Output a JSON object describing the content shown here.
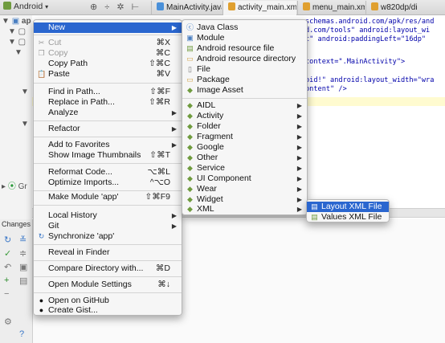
{
  "toolbar": {
    "project_view": "Android",
    "tabs": [
      {
        "label": "MainActivity.java",
        "icon": "java-file-icon"
      },
      {
        "label": "activity_main.xml",
        "icon": "xml-file-icon"
      },
      {
        "label": "menu_main.xml",
        "icon": "xml-file-icon"
      },
      {
        "label": "w820dp/di",
        "icon": "xml-file-icon"
      }
    ]
  },
  "tree": {
    "root": "ap",
    "gradle": "Gr"
  },
  "changes_label": "Changes",
  "code_lines": [
    "schemas.android.com/apk/res/and",
    "d.com/tools\" android:layout_wi",
    "t\" android:paddingLeft=\"16dp\"",
    "context=\".MainActivity\">",
    "oid!\" android:layout_width=\"wra",
    "ontent\" />"
  ],
  "main_menu": {
    "new": "New",
    "cut": "Cut",
    "cut_sc": "⌘X",
    "copy": "Copy",
    "copy_sc": "⌘C",
    "copy_path": "Copy Path",
    "copy_path_sc": "⇧⌘C",
    "paste": "Paste",
    "paste_sc": "⌘V",
    "find_in_path": "Find in Path...",
    "find_in_path_sc": "⇧⌘F",
    "replace_in_path": "Replace in Path...",
    "replace_in_path_sc": "⇧⌘R",
    "analyze": "Analyze",
    "refactor": "Refactor",
    "add_to_favorites": "Add to Favorites",
    "show_thumbnails": "Show Image Thumbnails",
    "show_thumbnails_sc": "⇧⌘T",
    "reformat": "Reformat Code...",
    "reformat_sc": "⌥⌘L",
    "optimize": "Optimize Imports...",
    "optimize_sc": "^⌥O",
    "make_module": "Make Module 'app'",
    "make_module_sc": "⇧⌘F9",
    "local_history": "Local History",
    "git": "Git",
    "synchronize": "Synchronize 'app'",
    "reveal": "Reveal in Finder",
    "compare": "Compare Directory with...",
    "compare_sc": "⌘D",
    "module_settings": "Open Module Settings",
    "module_settings_sc": "⌘↓",
    "open_github": "Open on GitHub",
    "create_gist": "Create Gist..."
  },
  "new_menu": {
    "java_class": "Java Class",
    "module": "Module",
    "android_resource_file": "Android resource file",
    "android_resource_directory": "Android resource directory",
    "file": "File",
    "package": "Package",
    "image_asset": "Image Asset",
    "aidl": "AIDL",
    "activity": "Activity",
    "folder": "Folder",
    "fragment": "Fragment",
    "google": "Google",
    "other": "Other",
    "service": "Service",
    "ui_component": "UI Component",
    "wear": "Wear",
    "widget": "Widget",
    "xml": "XML"
  },
  "xml_menu": {
    "layout_xml_file": "Layout XML File",
    "values_xml_file": "Values XML File"
  },
  "colors": {
    "selection": "#2a66cf",
    "android_green": "#6f9b3e"
  }
}
